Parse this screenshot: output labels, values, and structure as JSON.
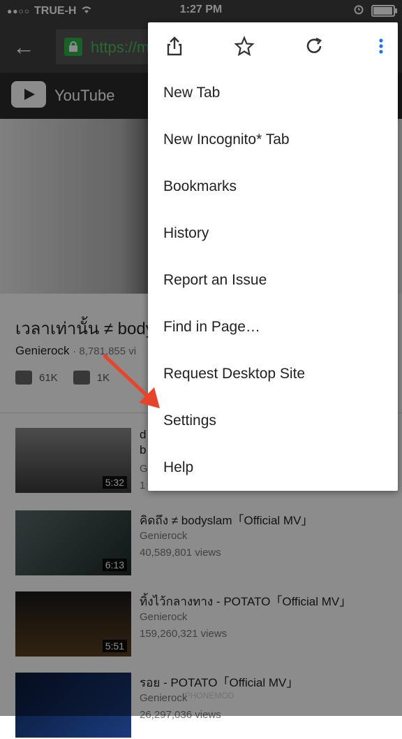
{
  "status_bar": {
    "carrier": "TRUE-H",
    "signal_dots": "●●○○",
    "time": "1:27 PM"
  },
  "browser": {
    "url": "https://m",
    "back_glyph": "←"
  },
  "youtube_bar": {
    "title": "YouTube"
  },
  "video": {
    "title": "เวลาเท่านั้น ≠ body",
    "channel": "Genierock",
    "views": "· 8,781,855 vi",
    "likes": "61K",
    "dislikes": "1K"
  },
  "related": [
    {
      "title": "d",
      "title2": "b",
      "channel": "G",
      "views": "1",
      "duration": "5:32"
    },
    {
      "title": "คิดถึง ≠ bodyslam「Official MV」",
      "channel": "Genierock",
      "views": "40,589,801 views",
      "duration": "6:13"
    },
    {
      "title": "ทิ้งไว้กลางทาง - POTATO「Official MV」",
      "channel": "Genierock",
      "views": "159,260,321 views",
      "duration": "5:51"
    },
    {
      "title": "รอย - POTATO「Official MV」",
      "channel": "Genierock",
      "views": "26,297,036 views",
      "duration": ""
    }
  ],
  "menu": {
    "icons": [
      "share-icon",
      "star-icon",
      "reload-icon",
      "more-vert-icon"
    ],
    "icon_glyphs": {
      "share": "⇧",
      "star": "☆",
      "reload": "↻",
      "more": "⋮"
    },
    "items": [
      "New Tab",
      "New Incognito* Tab",
      "Bookmarks",
      "History",
      "Report an Issue",
      "Find in Page…",
      "Request Desktop Site",
      "Settings",
      "Help"
    ]
  },
  "watermark": {
    "text": "iPHONEMOD"
  },
  "colors": {
    "toolbar": "#3e3e3e",
    "accent_green": "#2eb347",
    "menu_more_blue": "#1a73e8",
    "arrow_red": "#e8432b"
  }
}
